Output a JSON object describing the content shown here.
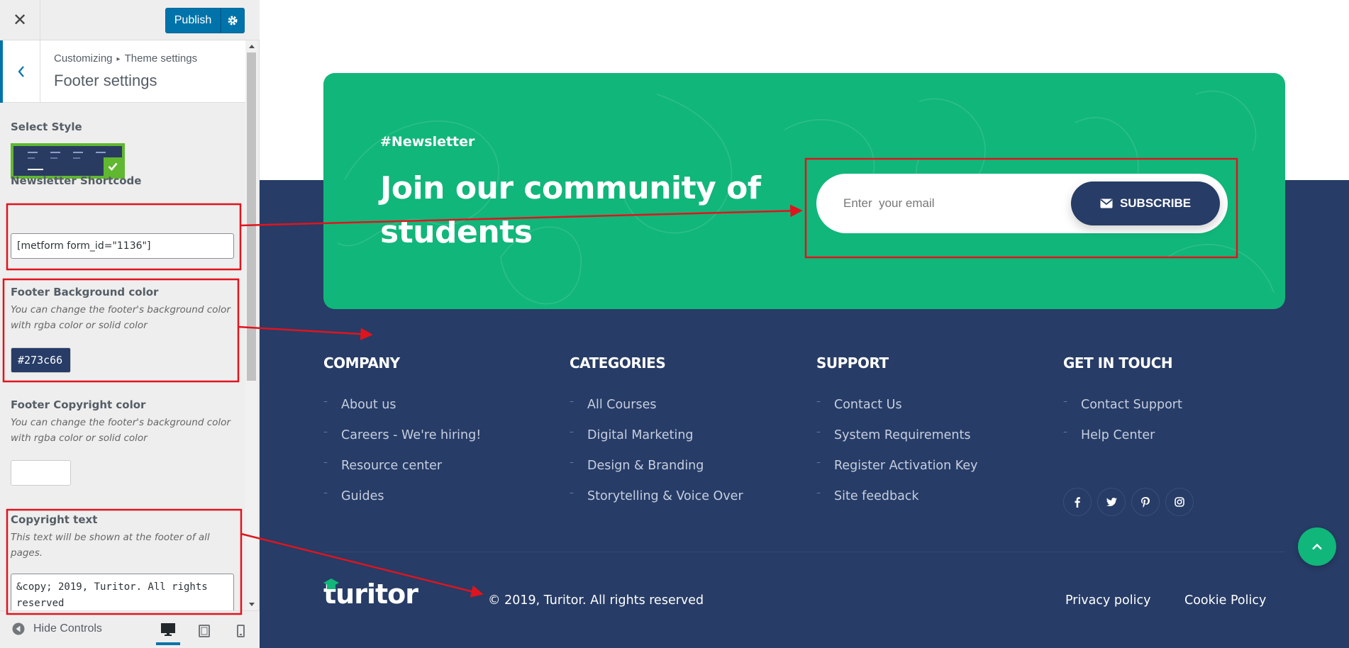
{
  "customizer": {
    "close_label": "✕",
    "publish_label": "Publish",
    "breadcrumb": [
      "Customizing",
      "Theme settings"
    ],
    "panel_title": "Footer settings",
    "controls": {
      "select_style_title": "Select Style",
      "shortcode_title": "Newsletter Shortcode",
      "shortcode_value": "[metform form_id=\"1136\"]",
      "bg_color_title": "Footer Background color",
      "bg_color_desc": "You can change the footer's background color with rgba color or solid color",
      "bg_color_value": "#273c66",
      "copy_color_title": "Footer Copyright color",
      "copy_color_desc": "You can change the footer's background color with rgba color or solid color",
      "copyright_title": "Copyright text",
      "copyright_desc": "This text will be shown at the footer of all pages.",
      "copyright_value": "&copy; 2019, Turitor. All rights reserved"
    },
    "footer": {
      "hide_controls_label": "Hide Controls"
    },
    "colors": {
      "accent": "#0073aa",
      "selected_style_border": "#60b830"
    }
  },
  "preview": {
    "newsletter": {
      "tag": "#Newsletter",
      "heading": "Join our community of students",
      "email_placeholder": "Enter  your email",
      "subscribe_label": "SUBSCRIBE",
      "subscribe_icon": "envelope-icon"
    },
    "columns": [
      {
        "title": "COMPANY",
        "links": [
          "About us",
          "Careers - We're hiring!",
          "Resource center",
          "Guides"
        ]
      },
      {
        "title": "CATEGORIES",
        "links": [
          "All Courses",
          "Digital Marketing",
          "Design & Branding",
          "Storytelling & Voice Over"
        ]
      },
      {
        "title": "SUPPORT",
        "links": [
          "Contact Us",
          "System Requirements",
          "Register Activation Key",
          "Site feedback"
        ]
      },
      {
        "title": "GET IN TOUCH",
        "links": [
          "Contact Support",
          "Help Center"
        ]
      }
    ],
    "social_icons": [
      "facebook-icon",
      "twitter-icon",
      "pinterest-icon",
      "instagram-icon"
    ],
    "logo_text": "turitor",
    "copyright": "© 2019, Turitor. All rights reserved",
    "privacy_label": "Privacy policy",
    "cookie_label": "Cookie Policy",
    "colors": {
      "footer_bg": "#273c66",
      "newsletter_bg": "#11b67a"
    }
  },
  "annotation_color": "#e0141e"
}
